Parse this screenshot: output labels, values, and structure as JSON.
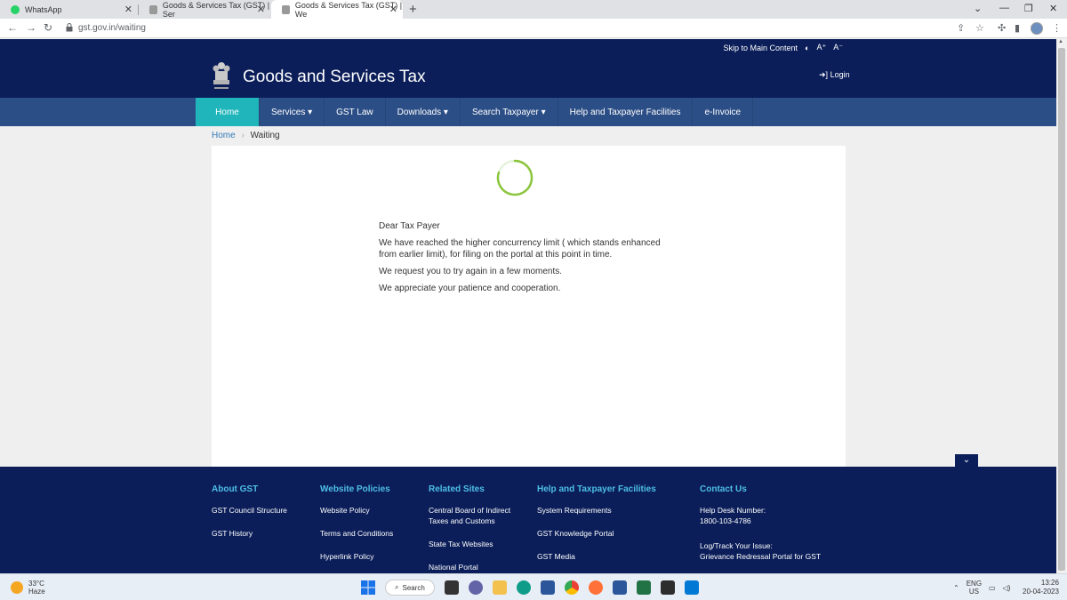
{
  "browser": {
    "tabs": [
      {
        "title": "WhatsApp",
        "icon": "whatsapp-icon",
        "color": "#25d366"
      },
      {
        "title": "Goods & Services Tax (GST) | Ser",
        "icon": "emblem-icon",
        "color": "#888888"
      },
      {
        "title": "Goods & Services Tax (GST) | We",
        "icon": "emblem-icon",
        "color": "#888888"
      }
    ],
    "url": "gst.gov.in/waiting"
  },
  "header": {
    "skip_link": "Skip to Main Content",
    "font_increase": "A⁺",
    "font_decrease": "A⁻",
    "title": "Goods and Services Tax",
    "login": "Login"
  },
  "nav": {
    "items": [
      {
        "label": "Home"
      },
      {
        "label": "Services ▾"
      },
      {
        "label": "GST Law"
      },
      {
        "label": "Downloads ▾"
      },
      {
        "label": "Search Taxpayer ▾"
      },
      {
        "label": "Help and Taxpayer Facilities"
      },
      {
        "label": "e-Invoice"
      }
    ]
  },
  "breadcrumb": {
    "home": "Home",
    "current": "Waiting"
  },
  "message": {
    "greeting": "Dear Tax Payer",
    "line1": "We have reached the higher concurrency limit ( which stands enhanced from earlier limit), for filing on the portal at this point in time.",
    "line2": "We request you to try again in a few moments.",
    "line3": "We appreciate your patience and cooperation."
  },
  "footer": {
    "about": {
      "heading": "About GST",
      "links": [
        "GST Council Structure",
        "GST History"
      ]
    },
    "policies": {
      "heading": "Website Policies",
      "links": [
        "Website Policy",
        "Terms and Conditions",
        "Hyperlink Policy"
      ]
    },
    "related": {
      "heading": "Related Sites",
      "links": [
        "Central Board of Indirect Taxes and Customs",
        "State Tax Websites",
        "National Portal"
      ]
    },
    "help": {
      "heading": "Help and Taxpayer Facilities",
      "links": [
        "System Requirements",
        "GST Knowledge Portal",
        "GST Media"
      ]
    },
    "contact": {
      "heading": "Contact Us",
      "helpdesk_label": "Help Desk Number:",
      "helpdesk_number": "1800-103-4786",
      "track_label": "Log/Track Your Issue:",
      "track_link": "Grievance Redressal Portal for GST"
    }
  },
  "taskbar": {
    "temperature": "33°C",
    "weather": "Haze",
    "search": "Search",
    "lang_top": "ENG",
    "lang_bottom": "US",
    "time": "13:26",
    "date": "20-04-2023"
  },
  "colors": {
    "header_bg": "#0b1e59",
    "nav_bg": "#2c4e86",
    "nav_active": "#1fb5ba",
    "footer_heading": "#4ebfe6",
    "spinner": "#8cc63f"
  }
}
